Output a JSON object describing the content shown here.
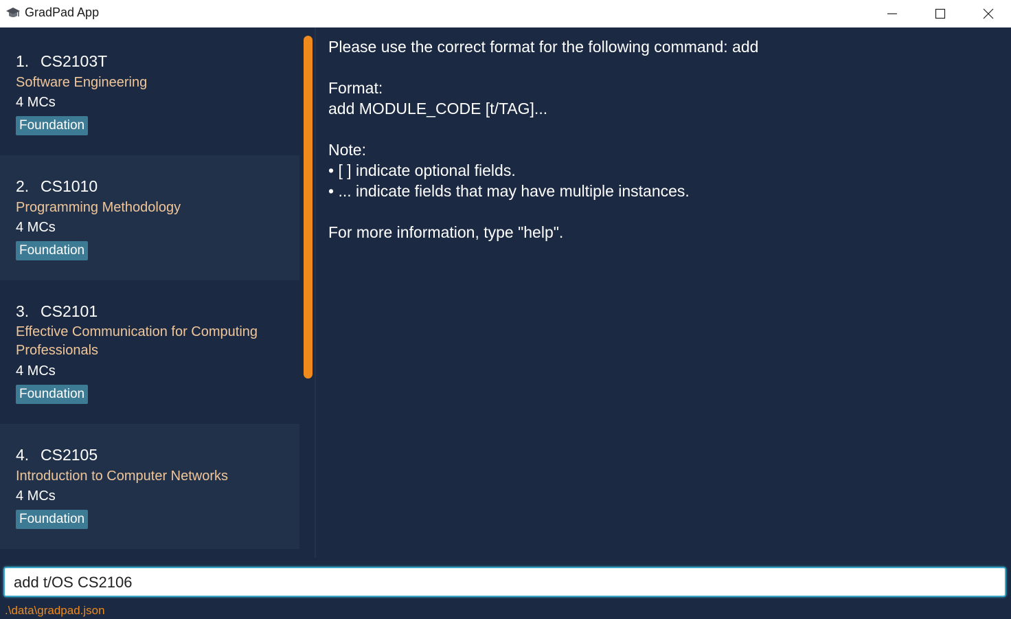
{
  "window": {
    "title": "GradPad App",
    "icon": "graduation-cap-icon"
  },
  "modules": [
    {
      "index": "1.",
      "code": "CS2103T",
      "title": "Software Engineering",
      "mcs": "4 MCs",
      "tag": "Foundation"
    },
    {
      "index": "2.",
      "code": "CS1010",
      "title": "Programming Methodology",
      "mcs": "4 MCs",
      "tag": "Foundation"
    },
    {
      "index": "3.",
      "code": "CS2101",
      "title": "Effective Communication for Computing Professionals",
      "mcs": "4 MCs",
      "tag": "Foundation"
    },
    {
      "index": "4.",
      "code": "CS2105",
      "title": "Introduction to Computer Networks",
      "mcs": "4 MCs",
      "tag": "Foundation"
    }
  ],
  "result": {
    "lines": [
      "Please use the correct format for the following command: add",
      "",
      "Format:",
      "add MODULE_CODE [t/TAG]...",
      "",
      "Note:",
      "• [ ] indicate optional fields.",
      "• ... indicate fields that may have multiple instances.",
      "",
      "For more information, type \"help\"."
    ]
  },
  "command": {
    "value": "add t/OS CS2106"
  },
  "status": {
    "path": ".\\data\\gradpad.json"
  },
  "colors": {
    "background": "#1b2a42",
    "card_alt": "#213149",
    "title_text": "#f0c69a",
    "tag": "#3d7a93",
    "accent": "#f08a1c",
    "focus": "#3aa6c8"
  }
}
